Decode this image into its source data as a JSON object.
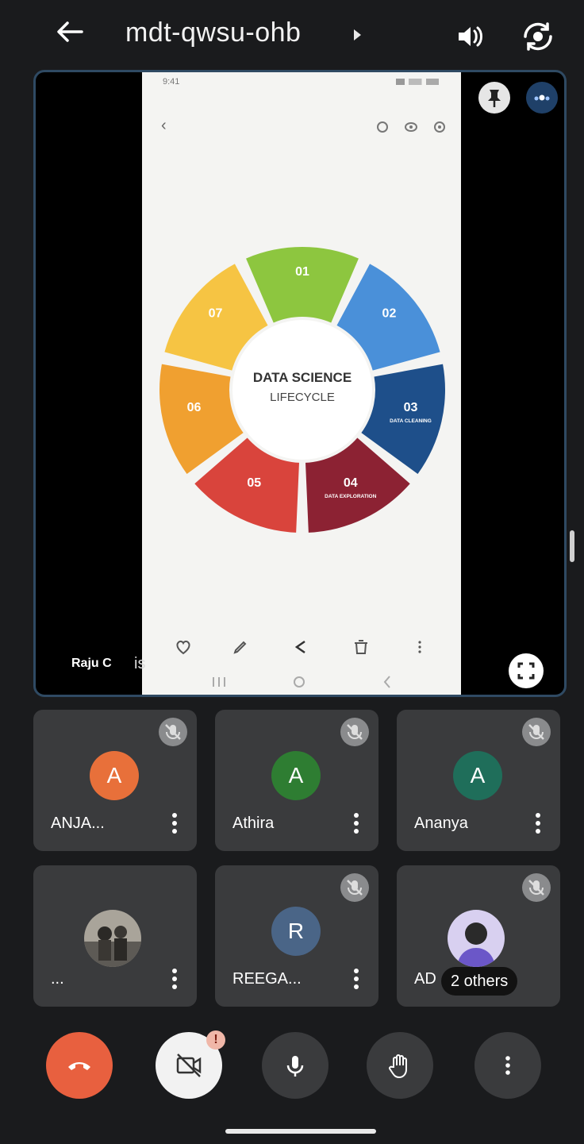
{
  "header": {
    "meeting_code": "mdt-qwsu-ohb",
    "icons": [
      "back-arrow-icon",
      "caret-right-icon",
      "speaker-icon",
      "switch-camera-icon"
    ]
  },
  "stage": {
    "presenter_name": "Raju C",
    "caption_fragment": "is",
    "shared_screen": {
      "status_time": "9:41",
      "center_title_line1": "DATA SCIENCE",
      "center_title_line2": "LIFECYCLE",
      "segments": [
        {
          "num": "01",
          "label": "",
          "color": "#8dc63f"
        },
        {
          "num": "02",
          "label": "",
          "color": "#4a90d9"
        },
        {
          "num": "03",
          "label": "DATA CLEANING",
          "color": "#1e4f8a"
        },
        {
          "num": "04",
          "label": "DATA EXPLORATION",
          "color": "#8c2233"
        },
        {
          "num": "05",
          "label": "",
          "color": "#d9443c"
        },
        {
          "num": "06",
          "label": "",
          "color": "#f0a030"
        },
        {
          "num": "07",
          "label": "",
          "color": "#f6c443"
        }
      ]
    }
  },
  "participants": [
    {
      "name": "ANJA...",
      "initial": "A",
      "color": "#e8703a",
      "muted": true
    },
    {
      "name": "Athira",
      "initial": "A",
      "color": "#2e7d32",
      "muted": true
    },
    {
      "name": "Ananya",
      "initial": "A",
      "color": "#1f6e5a",
      "muted": true
    },
    {
      "name": "...",
      "initial": "",
      "color": "#777777",
      "muted": false,
      "photo": true
    },
    {
      "name": "REEGA...",
      "initial": "R",
      "color": "#4a6587",
      "muted": true
    },
    {
      "name": "AD",
      "others": "2 others",
      "initial": "",
      "color": "#6a5acd",
      "muted": true,
      "photo": true
    }
  ],
  "controls": {
    "end_call_color": "#e8603f",
    "camera_alert": "!",
    "icons": [
      "end-call-icon",
      "camera-off-icon",
      "mic-icon",
      "raise-hand-icon",
      "more-options-icon"
    ]
  }
}
